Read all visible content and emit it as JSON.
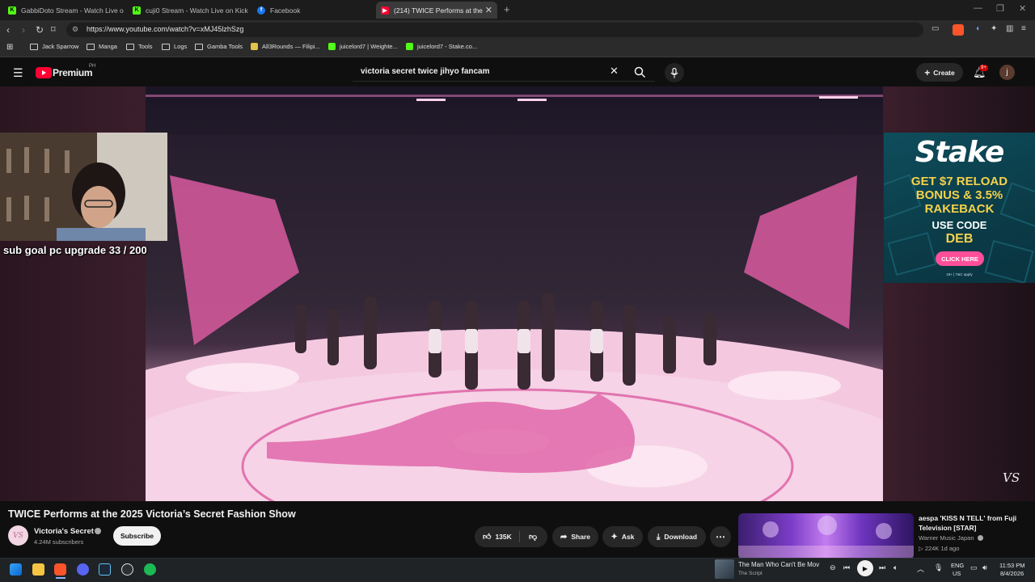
{
  "browser": {
    "tabs": [
      {
        "title": "GabbiDoto Stream - Watch Live o",
        "icon": "kick-icon"
      },
      {
        "title": "cuji0 Stream - Watch Live on Kick",
        "icon": "kick-icon"
      },
      {
        "title": "Facebook",
        "icon": "facebook-icon"
      },
      {
        "title": "(214) TWICE Performs at the",
        "icon": "youtube-icon",
        "active": true
      }
    ],
    "url": "https://www.youtube.com/watch?v=xMJ45lzhSzg",
    "bookmarks": [
      {
        "label": "Jack Sparrow",
        "type": "folder"
      },
      {
        "label": "Manga",
        "type": "folder"
      },
      {
        "label": "Tools",
        "type": "folder"
      },
      {
        "label": "Logs",
        "type": "folder"
      },
      {
        "label": "Gamba Tools",
        "type": "folder"
      },
      {
        "label": "All3Rounds — Filipi...",
        "type": "site"
      },
      {
        "label": "juicelord7 | Weighte...",
        "type": "site"
      },
      {
        "label": "juicelord7 - Stake.co...",
        "type": "site"
      }
    ]
  },
  "youtube": {
    "logo_text": "Premium",
    "region": "PH",
    "search_value": "victoria secret twice jihyo fancam",
    "create_label": "Create",
    "notif_count": "9+",
    "avatar_letter": "j",
    "video_title": "TWICE Performs at the 2025 Victoria’s Secret Fashion Show",
    "channel": "Victoria's Secret",
    "subscribers": "4.24M subscribers",
    "subscribe_label": "Subscribe",
    "likes": "135K",
    "share_label": "Share",
    "ask_label": "Ask",
    "download_label": "Download",
    "watermark": "VS"
  },
  "overlay": {
    "sub_goal": "sub goal pc upgrade 33 / 200"
  },
  "ad": {
    "brand": "Stake",
    "line1": "GET $7 RELOAD",
    "line2": "BONUS & 3.5%",
    "line3": "RAKEBACK",
    "line4": "USE CODE",
    "code": "DEB",
    "cta": "CLICK HERE",
    "terms": "18+ | T&C apply"
  },
  "recommendation": {
    "title": "aespa 'KISS N TELL' from Fuji Television [STAR]",
    "channel": "Warner Music Japan",
    "meta": "▷ 224K  1d ago"
  },
  "taskbar": {
    "media_title": "The Man Who Can't Be Mov",
    "media_artist": "The Script",
    "lang": "ENG",
    "region": "US",
    "time": "11:53 PM",
    "date": "8/4/2026",
    "colors": {
      "accent": "#ff0033",
      "kick": "#53fc18",
      "stake_pink": "#ff4f9a"
    }
  }
}
